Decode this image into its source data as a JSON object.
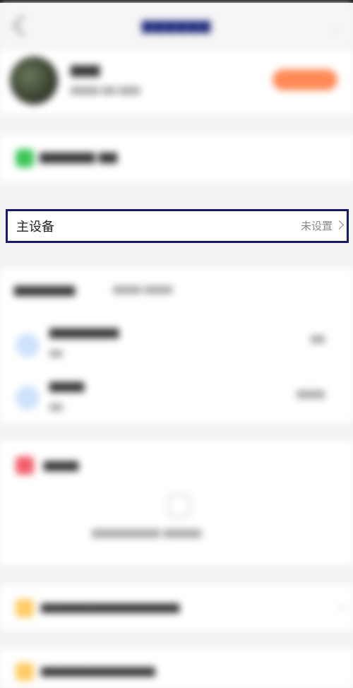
{
  "main_device": {
    "label": "主设备",
    "value": "未设置",
    "chevron_icon": "chevron-right-icon"
  },
  "colors": {
    "focus_border": "#1b1a6f",
    "accent_orange": "#ff8a57",
    "wechat_green": "#3cc75a",
    "security_red": "#f25e6b",
    "notice_yellow": "#ffcc66",
    "device_blue": "#cde2fb"
  }
}
